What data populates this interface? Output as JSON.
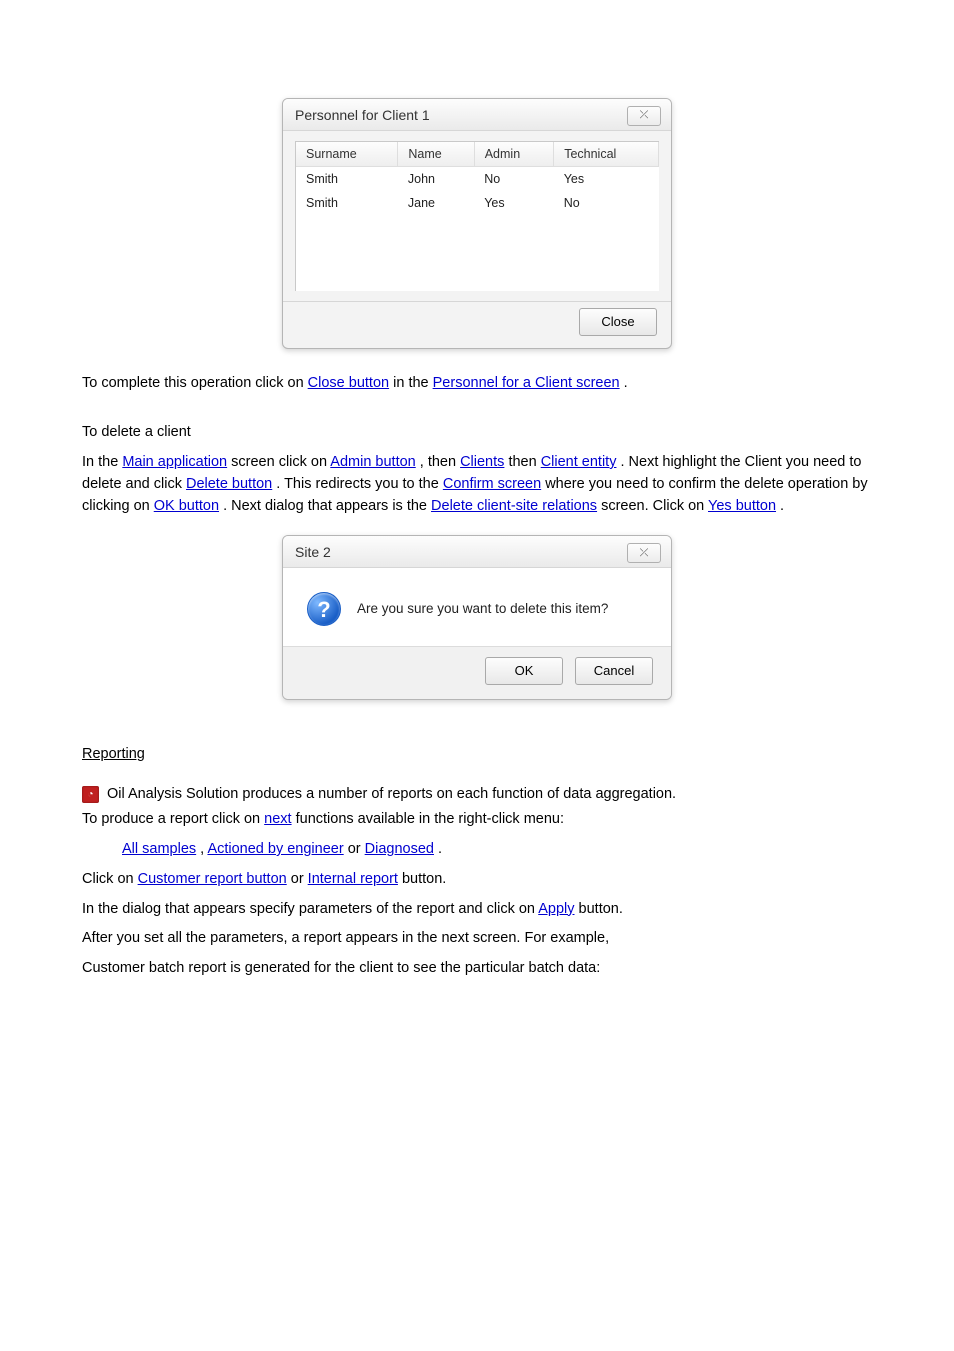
{
  "dialog1": {
    "title": "Personnel for Client 1",
    "close_glyph": "⤫",
    "columns": [
      "Surname",
      "Name",
      "Admin",
      "Technical"
    ],
    "rows": [
      [
        "Smith",
        "John",
        "No",
        "Yes"
      ],
      [
        "Smith",
        "Jane",
        "Yes",
        "No"
      ]
    ],
    "close_btn": "Close"
  },
  "para1": {
    "t1": "To complete this operation click on ",
    "link1": "Close button",
    "t2": " in the ",
    "link2": "Personnel for a Client screen",
    "t3": "."
  },
  "heading_delete": "To delete a client",
  "para2": {
    "t1": "In the ",
    "link1": "Main application",
    "t2": " screen click on ",
    "link2": "Admin button",
    "t3": ", then ",
    "link3": "Clients",
    "t4": " then ",
    "link4": "Client entity",
    "t5": ". Next highlight the Client you need to delete and click ",
    "link6": "Delete button",
    "t6": ". This redirects you to the ",
    "link7": "Confirm screen",
    "t7": " where you need to confirm the delete operation by clicking on ",
    "link8": "OK button",
    "t8": ". Next dialog that appears is the ",
    "link9": "Delete client-site relations",
    "t9": " screen. Click on ",
    "link10": "Yes button",
    "t10": "."
  },
  "dialog2": {
    "title": "Site 2",
    "close_glyph": "⤫",
    "message": "Are you sure you want to delete this item?",
    "ok": "OK",
    "cancel": "Cancel"
  },
  "reports": {
    "heading": "Reporting",
    "icon_glyph": "◔",
    "intro": "Oil Analysis Solution produces a number of reports on each function of data aggregation.",
    "line_a1": "To produce a report click on ",
    "line_a_link1": "next",
    "line_a2": " functions available in the right-click menu:",
    "links_line": {
      "l1": "All samples",
      "s1": ", ",
      "l2": "Actioned by engineer",
      "s2": " or ",
      "l3": "Diagnosed",
      "s3": "."
    },
    "line_b1": "Click on ",
    "line_b_link1": "Customer report button",
    "line_b2": " or ",
    "line_b_link2": "Internal report",
    "line_b3": " button.",
    "line_c1": "In the dialog that appears specify parameters of the report and click on ",
    "line_c_link1": "Apply",
    "line_c2": " button.",
    "line_d": "After you set all the parameters, a report appears in the next screen. For example,",
    "line_e": "Customer batch report is generated for the client to see the particular batch data:"
  }
}
